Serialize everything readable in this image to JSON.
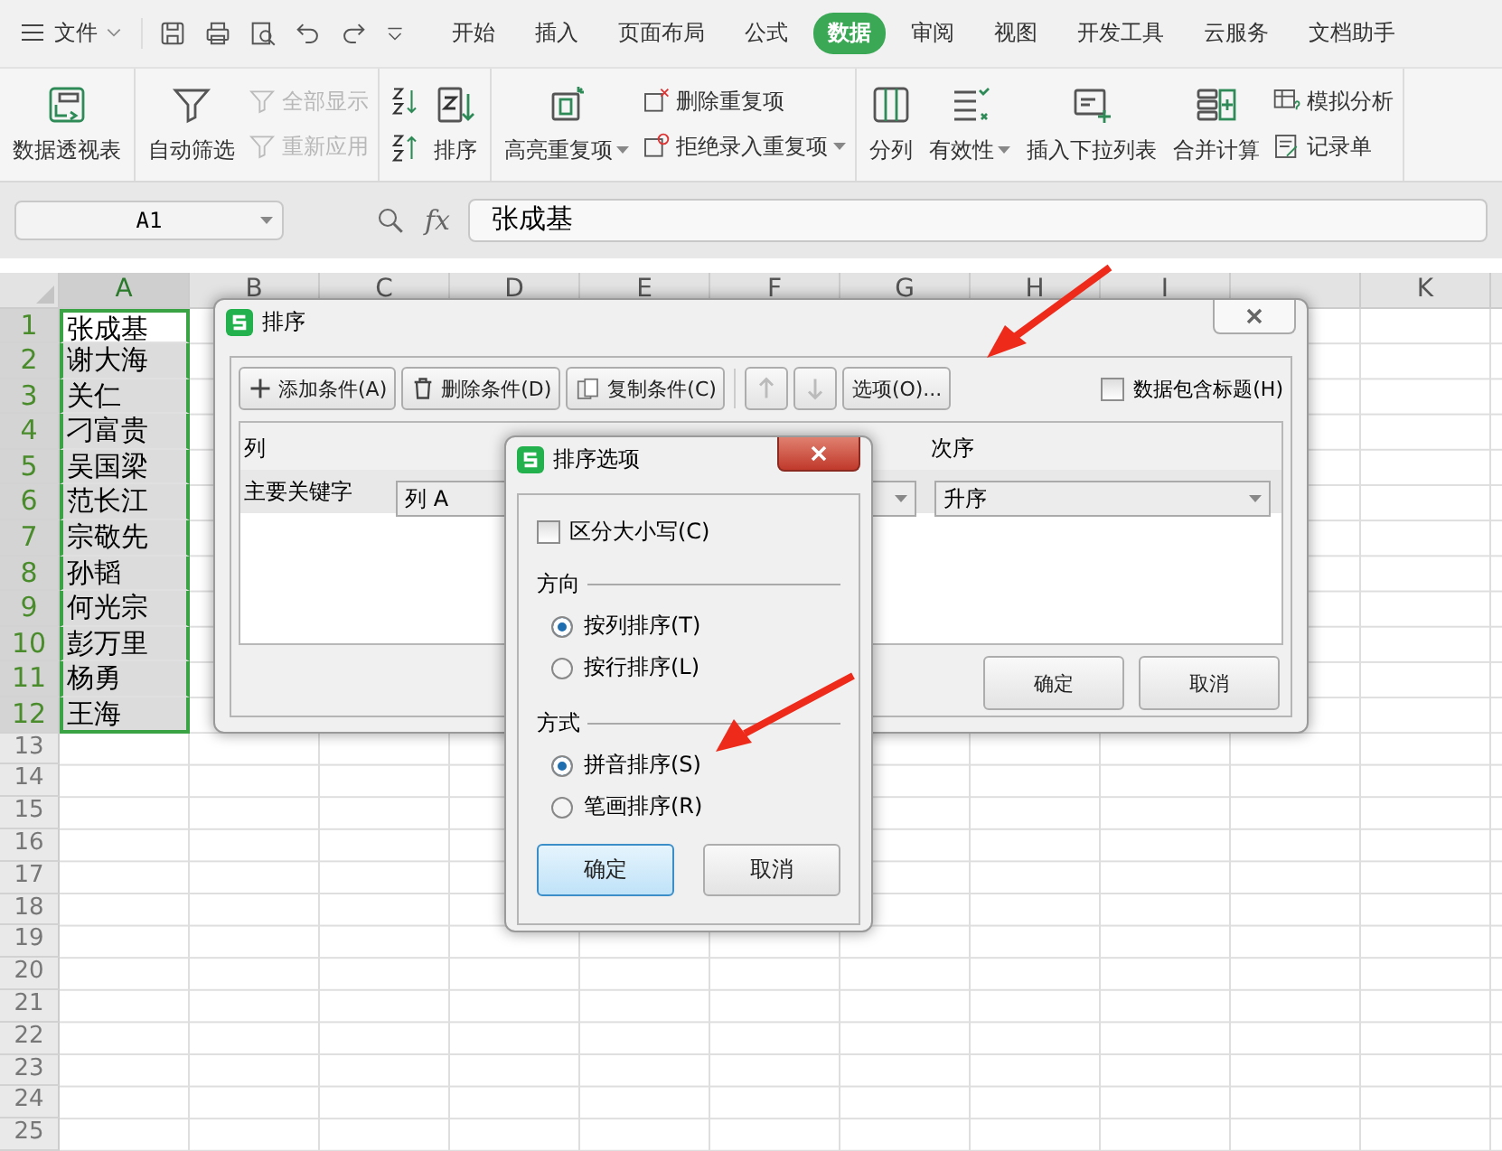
{
  "menu": {
    "file": "文件",
    "tabs": [
      {
        "label": "开始",
        "selected": false
      },
      {
        "label": "插入",
        "selected": false
      },
      {
        "label": "页面布局",
        "selected": false
      },
      {
        "label": "公式",
        "selected": false
      },
      {
        "label": "数据",
        "selected": true
      },
      {
        "label": "审阅",
        "selected": false
      },
      {
        "label": "视图",
        "selected": false
      },
      {
        "label": "开发工具",
        "selected": false
      },
      {
        "label": "云服务",
        "selected": false
      },
      {
        "label": "文档助手",
        "selected": false
      }
    ]
  },
  "ribbon": {
    "groups": [
      {
        "items": [
          {
            "kind": "large",
            "label": "数据透视表",
            "dropdown": false
          }
        ]
      },
      {
        "items": [
          {
            "kind": "large",
            "label": "自动筛选",
            "dropdown": false
          },
          {
            "kind": "stack",
            "items": [
              {
                "label": "全部显示",
                "disabled": true,
                "dropdown": false
              },
              {
                "label": "重新应用",
                "disabled": true,
                "dropdown": false
              }
            ]
          }
        ]
      },
      {
        "items": [
          {
            "kind": "sort-icons"
          },
          {
            "kind": "large",
            "label": "排序",
            "dropdown": false
          }
        ]
      },
      {
        "items": [
          {
            "kind": "large",
            "label": "高亮重复项",
            "dropdown": true
          },
          {
            "kind": "stack",
            "items": [
              {
                "label": "删除重复项",
                "disabled": false,
                "dropdown": false
              },
              {
                "label": "拒绝录入重复项",
                "disabled": false,
                "dropdown": true
              }
            ]
          }
        ]
      },
      {
        "items": [
          {
            "kind": "large",
            "label": "分列",
            "dropdown": false
          },
          {
            "kind": "large",
            "label": "有效性",
            "dropdown": true
          },
          {
            "kind": "large",
            "label": "插入下拉列表",
            "dropdown": false
          },
          {
            "kind": "large",
            "label": "合并计算",
            "dropdown": false
          },
          {
            "kind": "stack",
            "items": [
              {
                "label": "模拟分析",
                "disabled": false,
                "dropdown": false
              },
              {
                "label": "记录单",
                "disabled": false,
                "dropdown": false
              }
            ]
          }
        ]
      }
    ]
  },
  "formula_bar": {
    "cell_ref": "A1",
    "function_label": "fx",
    "value": "张成基"
  },
  "sheet": {
    "columns": [
      {
        "label": "A",
        "selected": true
      },
      {
        "label": "B",
        "selected": false
      },
      {
        "label": "C",
        "selected": false
      },
      {
        "label": "D",
        "selected": false
      },
      {
        "label": "E",
        "selected": false
      },
      {
        "label": "F",
        "selected": false
      },
      {
        "label": "G",
        "selected": false
      },
      {
        "label": "H",
        "selected": false
      },
      {
        "label": "I",
        "selected": false
      },
      {
        "selected": false
      },
      {
        "label": "K",
        "selected": false
      }
    ],
    "rows": [
      {
        "number": "1",
        "value": "张成基",
        "selected": true
      },
      {
        "number": "2",
        "value": "谢大海",
        "selected": true
      },
      {
        "number": "3",
        "value": "关仁",
        "selected": true
      },
      {
        "number": "4",
        "value": "刁富贵",
        "selected": true
      },
      {
        "number": "5",
        "value": "吴国梁",
        "selected": true
      },
      {
        "number": "6",
        "value": "范长江",
        "selected": true
      },
      {
        "number": "7",
        "value": "宗敬先",
        "selected": true
      },
      {
        "number": "8",
        "value": "孙韬",
        "selected": true
      },
      {
        "number": "9",
        "value": "何光宗",
        "selected": true
      },
      {
        "number": "10",
        "value": "彭万里",
        "selected": true
      },
      {
        "number": "11",
        "value": "杨勇",
        "selected": true
      },
      {
        "number": "12",
        "value": "王海",
        "selected": true
      },
      {
        "number": "13",
        "selected": false
      },
      {
        "number": "14",
        "selected": false
      },
      {
        "number": "15",
        "selected": false
      },
      {
        "number": "16",
        "selected": false
      },
      {
        "number": "17",
        "selected": false
      },
      {
        "number": "18",
        "selected": false
      },
      {
        "number": "19",
        "selected": false
      },
      {
        "number": "20",
        "selected": false
      },
      {
        "number": "21",
        "selected": false
      },
      {
        "number": "22",
        "selected": false
      },
      {
        "number": "23",
        "selected": false
      },
      {
        "number": "24",
        "selected": false
      },
      {
        "number": "25",
        "selected": false
      }
    ]
  },
  "sort_dialog": {
    "title": "排序",
    "toolbar": [
      {
        "kind": "add",
        "label": "添加条件(A)",
        "disabled": false
      },
      {
        "kind": "delete",
        "label": "删除条件(D)",
        "disabled": false
      },
      {
        "kind": "copy",
        "label": "复制条件(C)",
        "disabled": false
      },
      {
        "kind": "up",
        "disabled": true
      },
      {
        "kind": "down",
        "disabled": true
      },
      {
        "kind": "text",
        "label": "选项(O)...",
        "disabled": false
      }
    ],
    "header_checkbox": {
      "label": "数据包含标题(H)",
      "checked": false
    },
    "columns": [
      "列",
      "次序"
    ],
    "rows": [
      {
        "label": "主要关键字",
        "column": "列 A",
        "order": "升序"
      }
    ],
    "buttons": [
      "确定",
      "取消"
    ]
  },
  "options_dialog": {
    "title": "排序选项",
    "case_checkbox": {
      "label": "区分大小写(C)",
      "checked": false
    },
    "sections": [
      {
        "title": "方向",
        "options": [
          {
            "label": "按列排序(T)",
            "selected": true
          },
          {
            "label": "按行排序(L)",
            "selected": false
          }
        ]
      },
      {
        "title": "方式",
        "options": [
          {
            "label": "拼音排序(S)",
            "selected": true
          },
          {
            "label": "笔画排序(R)",
            "selected": false
          }
        ]
      }
    ],
    "buttons": [
      {
        "label": "确定",
        "focused": true
      },
      {
        "label": "取消",
        "focused": false
      }
    ]
  }
}
